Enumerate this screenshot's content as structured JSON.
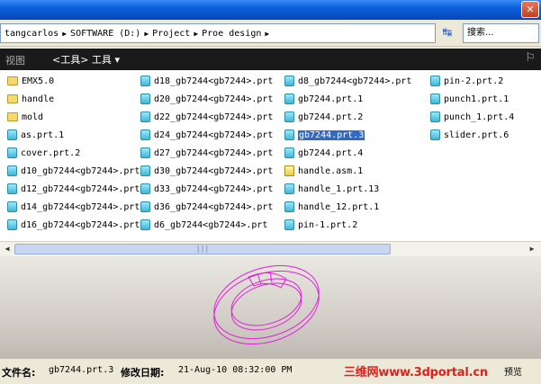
{
  "window": {
    "close_glyph": "✕"
  },
  "address": {
    "crumbs": [
      "tangcarlos",
      "SOFTWARE (D:)",
      "Project",
      "Proe design"
    ],
    "separator": "▶",
    "go_glyph": "↹"
  },
  "search": {
    "placeholder": "搜索..."
  },
  "toolbar": {
    "view_label": "视图",
    "tools_label": "<工具> 工具",
    "chevron": "▾",
    "end_icon": "⚐"
  },
  "files": {
    "columns": [
      [
        {
          "name": "EMX5.0",
          "kind": "folder"
        },
        {
          "name": "handle",
          "kind": "folder"
        },
        {
          "name": "mold",
          "kind": "folder"
        },
        {
          "name": "as.prt.1",
          "kind": "part"
        },
        {
          "name": "cover.prt.2",
          "kind": "part"
        },
        {
          "name": "d10_gb7244<gb7244>.prt",
          "kind": "part"
        },
        {
          "name": "d12_gb7244<gb7244>.prt",
          "kind": "part"
        },
        {
          "name": "d14_gb7244<gb7244>.prt",
          "kind": "part"
        },
        {
          "name": "d16_gb7244<gb7244>.prt",
          "kind": "part"
        }
      ],
      [
        {
          "name": "d18_gb7244<gb7244>.prt",
          "kind": "part"
        },
        {
          "name": "d20_gb7244<gb7244>.prt",
          "kind": "part"
        },
        {
          "name": "d22_gb7244<gb7244>.prt",
          "kind": "part"
        },
        {
          "name": "d24_gb7244<gb7244>.prt",
          "kind": "part"
        },
        {
          "name": "d27_gb7244<gb7244>.prt",
          "kind": "part"
        },
        {
          "name": "d30_gb7244<gb7244>.prt",
          "kind": "part"
        },
        {
          "name": "d33_gb7244<gb7244>.prt",
          "kind": "part"
        },
        {
          "name": "d36_gb7244<gb7244>.prt",
          "kind": "part"
        },
        {
          "name": "d6_gb7244<gb7244>.prt",
          "kind": "part"
        }
      ],
      [
        {
          "name": "d8_gb7244<gb7244>.prt",
          "kind": "part"
        },
        {
          "name": "gb7244.prt.1",
          "kind": "part"
        },
        {
          "name": "gb7244.prt.2",
          "kind": "part"
        },
        {
          "name": "gb7244.prt.3",
          "kind": "part",
          "selected": true
        },
        {
          "name": "gb7244.prt.4",
          "kind": "part"
        },
        {
          "name": "handle.asm.1",
          "kind": "asm"
        },
        {
          "name": "handle_1.prt.13",
          "kind": "part"
        },
        {
          "name": "handle_12.prt.1",
          "kind": "part"
        },
        {
          "name": "pin-1.prt.2",
          "kind": "part"
        }
      ],
      [
        {
          "name": "pin-2.prt.2",
          "kind": "part"
        },
        {
          "name": "punch1.prt.1",
          "kind": "part"
        },
        {
          "name": "punch_1.prt.4",
          "kind": "part"
        },
        {
          "name": "slider.prt.6",
          "kind": "part"
        }
      ]
    ]
  },
  "scrollbar": {
    "left_arrow": "◀",
    "right_arrow": "▶",
    "grip": "|||"
  },
  "status": {
    "filename_label": "文件名:",
    "filename_value": "gb7244.prt.3",
    "modified_label": "修改日期:",
    "modified_value": "21-Aug-10 08:32:00 PM",
    "watermark": "三维网www.3dportal.cn",
    "end_text": "预览"
  },
  "colors": {
    "preview_wire": "#e020d8",
    "selection": "#316ac5",
    "watermark": "#e0201a"
  }
}
